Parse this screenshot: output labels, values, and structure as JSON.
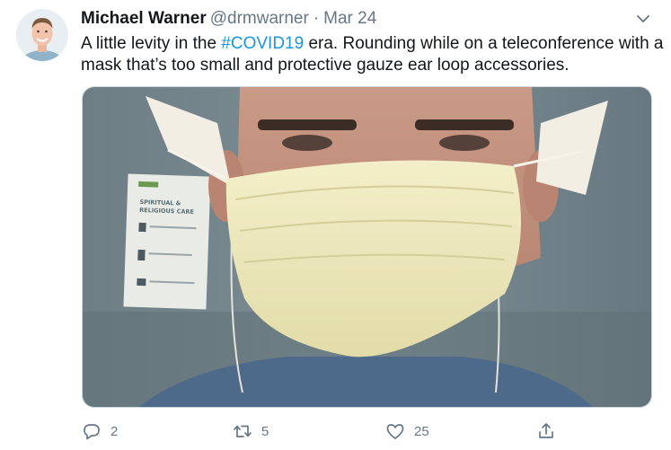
{
  "tweet": {
    "author": {
      "display_name": "Michael Warner",
      "handle": "@drmwarner",
      "separator": "·",
      "date": "Mar 24"
    },
    "text_before": "A little levity in the ",
    "hashtag": "#COVID19",
    "text_after": " era. Rounding while on a teleconference with a mask that’s too small and protective gauze ear loop accessories.",
    "media": {
      "poster_title_line1": "SPIRITUAL &",
      "poster_title_line2": "RELIGIOUS CARE"
    },
    "actions": {
      "reply_count": "2",
      "retweet_count": "5",
      "like_count": "25"
    }
  },
  "icons": {
    "menu": "chevron-down-icon",
    "reply": "reply-icon",
    "retweet": "retweet-icon",
    "like": "heart-icon",
    "share": "share-icon"
  },
  "colors": {
    "text": "#14171a",
    "secondary": "#657786",
    "link": "#1b95e0",
    "border": "#ccd6dd"
  }
}
